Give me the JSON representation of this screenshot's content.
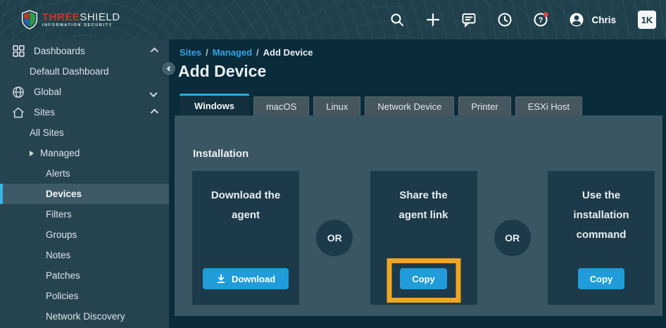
{
  "topbar": {
    "logo": {
      "brand_bold": "THREE",
      "brand_light": "SHIELD",
      "tagline": "INFORMATION SECURITY"
    },
    "icons": [
      "search",
      "add",
      "messages",
      "history",
      "help",
      "account"
    ],
    "user_name": "Chris",
    "badge_label": "1K"
  },
  "sidebar": {
    "items": [
      {
        "label": "Dashboards"
      },
      {
        "label": "Default Dashboard"
      },
      {
        "label": "Global"
      },
      {
        "label": "Sites"
      },
      {
        "label": "All Sites"
      },
      {
        "label": "Managed"
      },
      {
        "label": "Alerts"
      },
      {
        "label": "Devices"
      },
      {
        "label": "Filters"
      },
      {
        "label": "Groups"
      },
      {
        "label": "Notes"
      },
      {
        "label": "Patches"
      },
      {
        "label": "Policies"
      },
      {
        "label": "Network Discovery"
      }
    ],
    "selected_item": "Devices"
  },
  "breadcrumb": {
    "crumb1": "Sites",
    "sep1": "/",
    "crumb2": "Managed",
    "sep2": "/",
    "crumb3": "Add Device"
  },
  "page": {
    "title": "Add Device"
  },
  "tabs": [
    {
      "label": "Windows",
      "active": true
    },
    {
      "label": "macOS",
      "active": false
    },
    {
      "label": "Linux",
      "active": false
    },
    {
      "label": "Network Device",
      "active": false
    },
    {
      "label": "Printer",
      "active": false
    },
    {
      "label": "ESXi Host",
      "active": false
    }
  ],
  "installation": {
    "heading": "Installation",
    "separator_label": "OR",
    "cards": [
      {
        "title_line1": "Download the",
        "title_line2": "agent",
        "button_label": "Download"
      },
      {
        "title_line1": "Share the",
        "title_line2": "agent link",
        "button_label": "Copy",
        "highlighted": true
      },
      {
        "title_line1": "Use the",
        "title_line2": "installation",
        "title_line3": "command",
        "button_label": "Copy"
      }
    ]
  },
  "colors": {
    "topbar_bg": "#20414c",
    "sidebar_bg": "#264350",
    "content_bg": "#092b3a",
    "panel_bg": "#3b5663",
    "card_bg": "#1d3a4a",
    "button_blue": "#1f9cd9",
    "link_blue": "#36a3e8",
    "tab_active_border": "#2baadf",
    "selected_item_bar": "#35b5e8",
    "highlight_orange": "#f0a621",
    "notification_red": "#e5413d"
  }
}
